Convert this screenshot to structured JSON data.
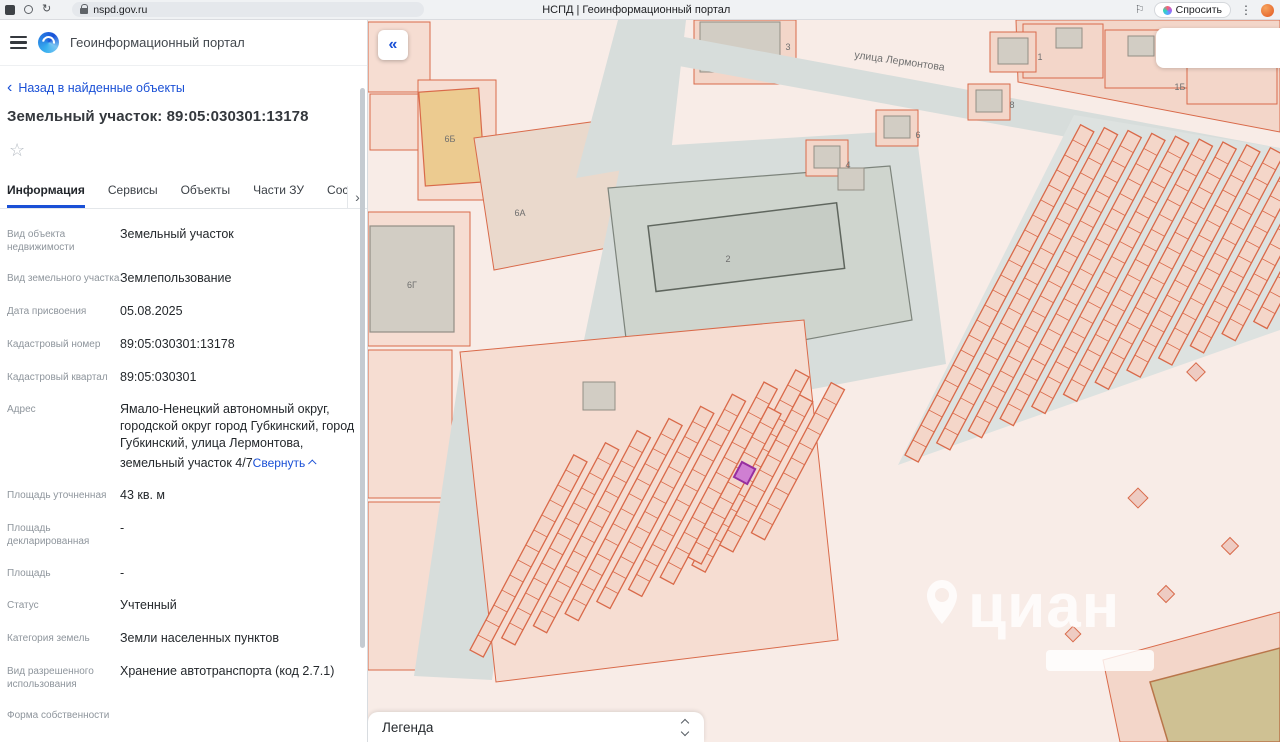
{
  "browser": {
    "url": "nspd.gov.ru",
    "page_title": "НСПД | Геоинформационный портал",
    "ask_button": "Спросить"
  },
  "panel": {
    "portal_title": "Геоинформационный портал",
    "back_link": "Назад в найденные объекты",
    "object_title": "Земельный участок: 89:05:030301:13178",
    "tabs": [
      "Информация",
      "Сервисы",
      "Объекты",
      "Части ЗУ",
      "Соста"
    ],
    "active_tab": "Информация",
    "fields": [
      {
        "label": "Вид объекта недвижимости",
        "value": "Земельный участок"
      },
      {
        "label": "Вид земельного участка",
        "value": "Землепользование"
      },
      {
        "label": "Дата присвоения",
        "value": "05.08.2025"
      },
      {
        "label": "Кадастровый номер",
        "value": "89:05:030301:13178"
      },
      {
        "label": "Кадастровый квартал",
        "value": "89:05:030301"
      },
      {
        "label": "Адрес",
        "value": "Ямало-Ненецкий автономный округ, городской округ город Губкинский, город Губкинский, улица Лермонтова, земельный участок 4/7",
        "action": "Свернуть"
      },
      {
        "label": "Площадь уточненная",
        "value": "43 кв. м"
      },
      {
        "label": "Площадь декларированная",
        "value": "-"
      },
      {
        "label": "Площадь",
        "value": "-"
      },
      {
        "label": "Статус",
        "value": "Учтенный"
      },
      {
        "label": "Категория земель",
        "value": "Земли населенных пунктов"
      },
      {
        "label": "Вид разрешенного использования",
        "value": "Хранение автотранспорта (код 2.7.1)"
      },
      {
        "label": "Форма собственности",
        "value": ""
      }
    ]
  },
  "map": {
    "street_label": "улица Лермонтова",
    "parcel_labels": [
      "3",
      "1",
      "8",
      "6",
      "4",
      "2",
      "6А",
      "6Б",
      "6Г",
      "1Б"
    ],
    "legend_title": "Легенда",
    "watermark": "циан",
    "collapse_button": "«"
  },
  "icons": {
    "star": "☆",
    "back": "‹",
    "more": "›",
    "dots": "⋮",
    "bookmark": "⚐",
    "reload": "↻"
  },
  "colors": {
    "accent_blue": "#1a50d6",
    "parcel_stroke": "#d96a4a",
    "parcel_fill": "#f4d6c9",
    "highlight_fill": "#cf7fd2",
    "highlight_stroke": "#962fa0",
    "road_gray": "#d7dddb"
  }
}
